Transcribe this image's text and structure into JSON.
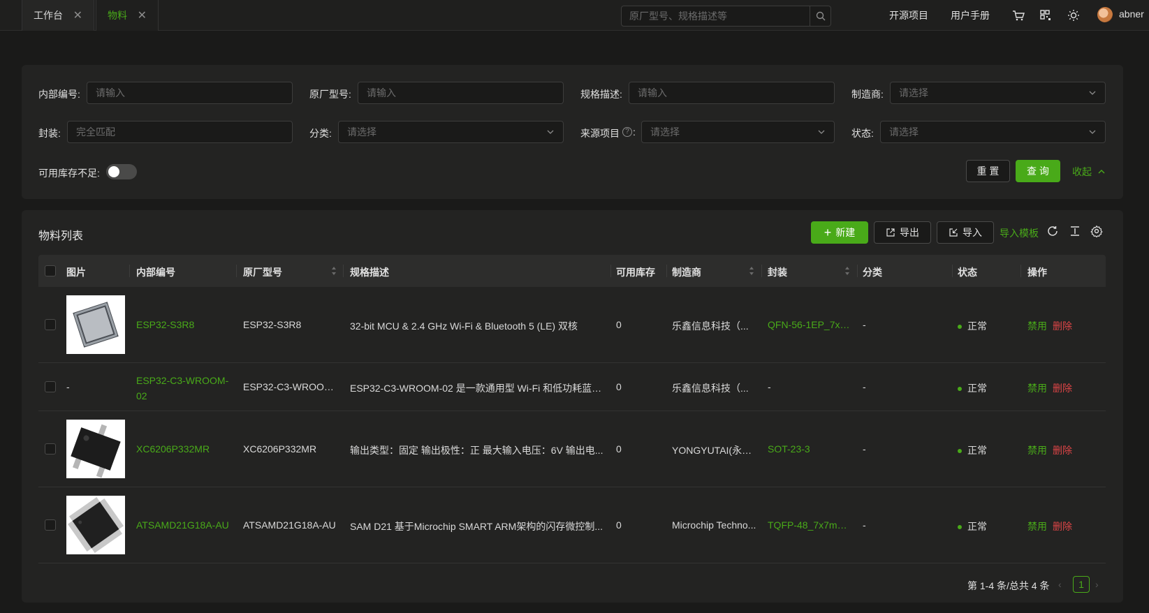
{
  "tabs": [
    {
      "label": "工作台",
      "active": false
    },
    {
      "label": "物料",
      "active": true
    }
  ],
  "header": {
    "search_placeholder": "原厂型号、规格描述等",
    "links": [
      "开源项目",
      "用户手册"
    ],
    "username": "abner",
    "icons": [
      "cart-icon",
      "grid-qr-icon",
      "sun-icon"
    ]
  },
  "filter": {
    "internal_no": {
      "label": "内部编号:",
      "placeholder": "请输入"
    },
    "mfr_model": {
      "label": "原厂型号:",
      "placeholder": "请输入"
    },
    "spec": {
      "label": "规格描述:",
      "placeholder": "请输入"
    },
    "manufacturer": {
      "label": "制造商:",
      "placeholder": "请选择"
    },
    "package": {
      "label": "封装:",
      "placeholder": "完全匹配"
    },
    "category": {
      "label": "分类:",
      "placeholder": "请选择"
    },
    "source_project": {
      "label": "来源项目",
      "placeholder": "请选择"
    },
    "status": {
      "label": "状态:",
      "placeholder": "请选择"
    },
    "low_stock": {
      "label": "可用库存不足:",
      "on": false
    },
    "reset_label": "重 置",
    "query_label": "查 询",
    "collapse_label": "收起"
  },
  "list": {
    "title": "物料列表",
    "new_label": "新建",
    "export_label": "导出",
    "import_label": "导入",
    "template_label": "导入模板",
    "columns": [
      "图片",
      "内部编号",
      "原厂型号",
      "规格描述",
      "可用库存",
      "制造商",
      "封装",
      "分类",
      "状态",
      "操作"
    ],
    "rows": [
      {
        "internal": "ESP32-S3R8",
        "model": "ESP32-S3R8",
        "spec": "32-bit MCU & 2.4 GHz Wi-Fi & Bluetooth 5 (LE) 双核",
        "stock": "0",
        "mfr": "乐鑫信息科技（...",
        "package": "QFN-56-1EP_7x7...",
        "category": "-",
        "status": "正常",
        "image": "qfn"
      },
      {
        "internal": "ESP32-C3-WROOM-02",
        "model": "ESP32-C3-WROOM-...",
        "spec": "ESP32-C3-WROOM-02 是一款通用型 Wi-Fi 和低功耗蓝牙...",
        "stock": "0",
        "mfr": "乐鑫信息科技（...",
        "package": "-",
        "category": "-",
        "status": "正常",
        "image": "-"
      },
      {
        "internal": "XC6206P332MR",
        "model": "XC6206P332MR",
        "spec": "输出类型：固定 输出极性：正 最大输入电压：6V 输出电...",
        "stock": "0",
        "mfr": "YONGYUTAI(永裕...",
        "package": "SOT-23-3",
        "category": "-",
        "status": "正常",
        "image": "sot"
      },
      {
        "internal": "ATSAMD21G18A-AU",
        "model": "ATSAMD21G18A-AU",
        "spec": "SAM D21 基于Microchip SMART ARM架构的闪存微控制...",
        "stock": "0",
        "mfr": "Microchip Techno...",
        "package": "TQFP-48_7x7mm...",
        "category": "-",
        "status": "正常",
        "image": "tqfp"
      }
    ],
    "action_disable": "禁用",
    "action_delete": "删除",
    "pager_text": "第 1-4 条/总共 4 条",
    "current_page": "1"
  }
}
